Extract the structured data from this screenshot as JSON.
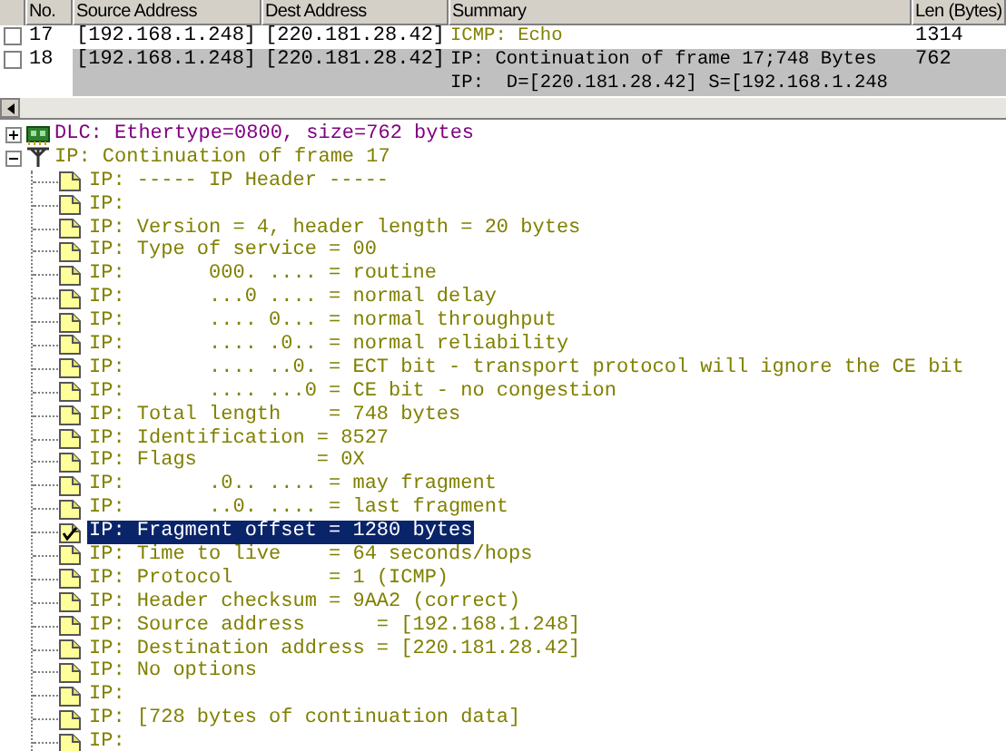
{
  "packet_list": {
    "columns": [
      "No.",
      "Source Address",
      "Dest Address",
      "Summary",
      "Len (Bytes)"
    ],
    "rows": [
      {
        "no": "17",
        "source": "[192.168.1.248]",
        "dest": "[220.181.28.42]",
        "summary": [
          "ICMP: Echo"
        ],
        "len": "1314",
        "color": "#808000",
        "selected": false
      },
      {
        "no": "18",
        "source": "[192.168.1.248]",
        "dest": "[220.181.28.42]",
        "summary": [
          "IP: Continuation of frame 17;748 Bytes",
          "IP:  D=[220.181.28.42] S=[192.168.1.248"
        ],
        "len": "762",
        "color": "#000000",
        "selected": true
      }
    ]
  },
  "detail_tree": [
    {
      "text": "DLC: Ethertype=0800, size=762 bytes",
      "kind": "dlc",
      "expanded": false,
      "color": "#800080"
    },
    {
      "text": "IP: Continuation of frame 17",
      "kind": "ip",
      "expanded": true,
      "color": "#808000",
      "children": [
        {
          "text": "IP: ----- IP Header -----",
          "selected": false
        },
        {
          "text": "IP:",
          "selected": false
        },
        {
          "text": "IP: Version = 4, header length = 20 bytes",
          "selected": false
        },
        {
          "text": "IP: Type of service = 00",
          "selected": false
        },
        {
          "text": "IP:       000. .... = routine",
          "selected": false
        },
        {
          "text": "IP:       ...0 .... = normal delay",
          "selected": false
        },
        {
          "text": "IP:       .... 0... = normal throughput",
          "selected": false
        },
        {
          "text": "IP:       .... .0.. = normal reliability",
          "selected": false
        },
        {
          "text": "IP:       .... ..0. = ECT bit - transport protocol will ignore the CE bit",
          "selected": false
        },
        {
          "text": "IP:       .... ...0 = CE bit - no congestion",
          "selected": false
        },
        {
          "text": "IP: Total length    = 748 bytes",
          "selected": false
        },
        {
          "text": "IP: Identification = 8527",
          "selected": false
        },
        {
          "text": "IP: Flags          = 0X",
          "selected": false
        },
        {
          "text": "IP:       .0.. .... = may fragment",
          "selected": false
        },
        {
          "text": "IP:       ..0. .... = last fragment",
          "selected": false
        },
        {
          "text": "IP: Fragment offset = 1280 bytes",
          "selected": true
        },
        {
          "text": "IP: Time to live    = 64 seconds/hops",
          "selected": false
        },
        {
          "text": "IP: Protocol        = 1 (ICMP)",
          "selected": false
        },
        {
          "text": "IP: Header checksum = 9AA2 (correct)",
          "selected": false
        },
        {
          "text": "IP: Source address      = [192.168.1.248]",
          "selected": false
        },
        {
          "text": "IP: Destination address = [220.181.28.42]",
          "selected": false
        },
        {
          "text": "IP: No options",
          "selected": false
        },
        {
          "text": "IP:",
          "selected": false
        },
        {
          "text": "IP: [728 bytes of continuation data]",
          "selected": false
        },
        {
          "text": "IP:",
          "selected": false
        }
      ]
    }
  ]
}
